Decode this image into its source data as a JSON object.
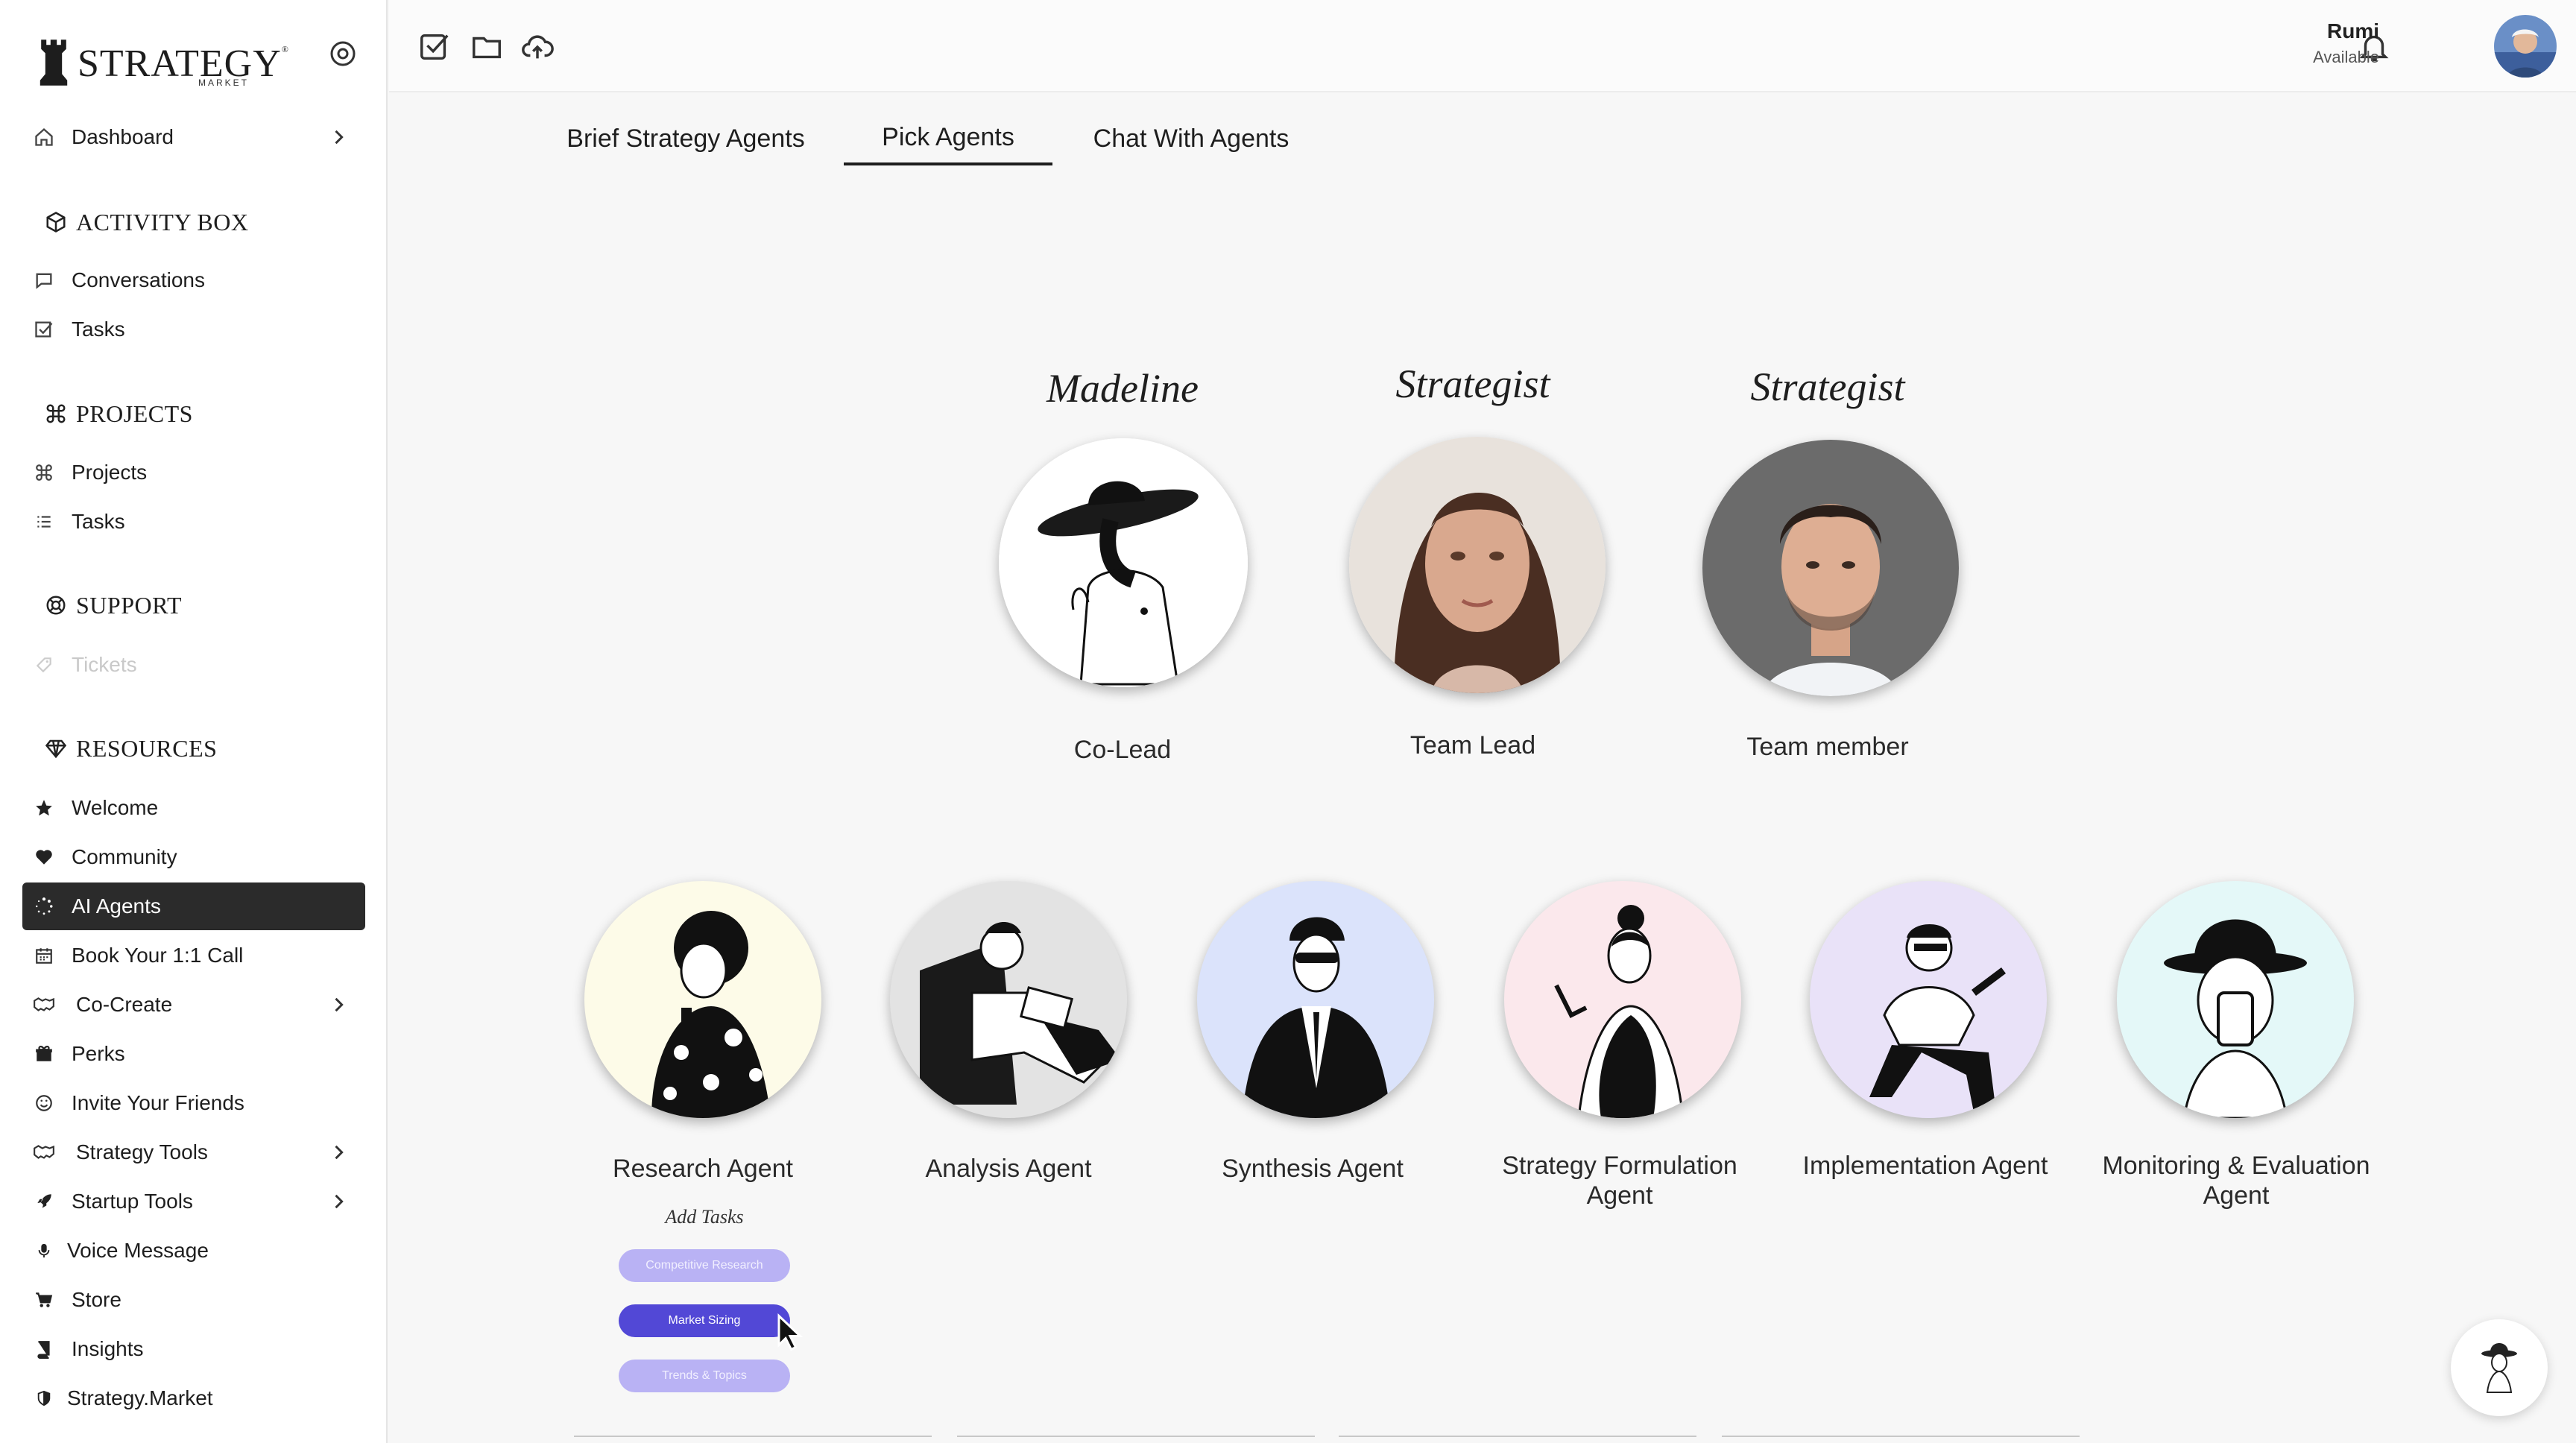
{
  "brand": {
    "name": "STRATEGY",
    "reg": "®",
    "sub": "MARKET"
  },
  "sidebar": {
    "dashboard": "Dashboard",
    "activity_box": {
      "title": "ACTIVITY BOX",
      "items": [
        "Conversations",
        "Tasks"
      ]
    },
    "projects": {
      "title": "PROJECTS",
      "items": [
        "Projects",
        "Tasks"
      ]
    },
    "support": {
      "title": "SUPPORT",
      "items": [
        "Tickets"
      ]
    },
    "resources": {
      "title": "RESOURCES",
      "items": [
        "Welcome",
        "Community",
        "AI Agents",
        "Book Your 1:1 Call",
        "Co-Create",
        "Perks",
        "Invite Your Friends",
        "Strategy Tools",
        "Startup Tools",
        "Voice Message",
        "Store",
        "Insights",
        "Strategy.Market"
      ]
    },
    "active_item": "AI Agents"
  },
  "topbar": {
    "user_name": "Rumi",
    "user_status": "Available"
  },
  "tabs": [
    "Brief Strategy Agents",
    "Pick Agents",
    "Chat With Agents"
  ],
  "active_tab": "Pick Agents",
  "leads": [
    {
      "script": "Madeline",
      "role": "Co-Lead"
    },
    {
      "script": "Strategist",
      "role": "Team Lead"
    },
    {
      "script": "Strategist",
      "role": "Team member"
    }
  ],
  "agents": [
    {
      "name": "Research Agent",
      "bg": "#fdfbe8"
    },
    {
      "name": "Analysis Agent",
      "bg": "#e3e3e3"
    },
    {
      "name": "Synthesis Agent",
      "bg": "#dbe3fb"
    },
    {
      "name": "Strategy Formulation Agent",
      "bg": "#fbe8ec"
    },
    {
      "name": "Implementation Agent",
      "bg": "#e9e2f8"
    },
    {
      "name": "Monitoring & Evaluation Agent",
      "bg": "#e4f8f8"
    }
  ],
  "add_tasks": {
    "title": "Add Tasks",
    "tasks": [
      "Competitive Research",
      "Market Sizing",
      "Trends & Topics"
    ],
    "selected": "Market Sizing"
  },
  "colors": {
    "active_nav": "#2b2b2b",
    "pill_selected": "#5248d6",
    "pill_unselected": "#b9b2f4"
  }
}
